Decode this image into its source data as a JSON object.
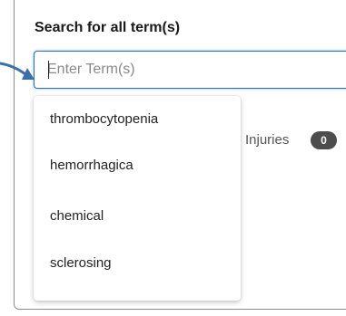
{
  "search": {
    "label": "Search for all term(s)",
    "placeholder": "Enter Term(s)",
    "value": ""
  },
  "filter": {
    "label": "Injuries",
    "count": "0"
  },
  "suggestions": [
    "thrombocytopenia",
    "hemorrhagica",
    "chemical",
    "sclerosing"
  ],
  "colors": {
    "input_border": "#2e6eb3",
    "arrow": "#3a6fa8",
    "badge": "#4d4d4d"
  },
  "icons": {
    "pointer": "arrow-pointer-icon"
  }
}
